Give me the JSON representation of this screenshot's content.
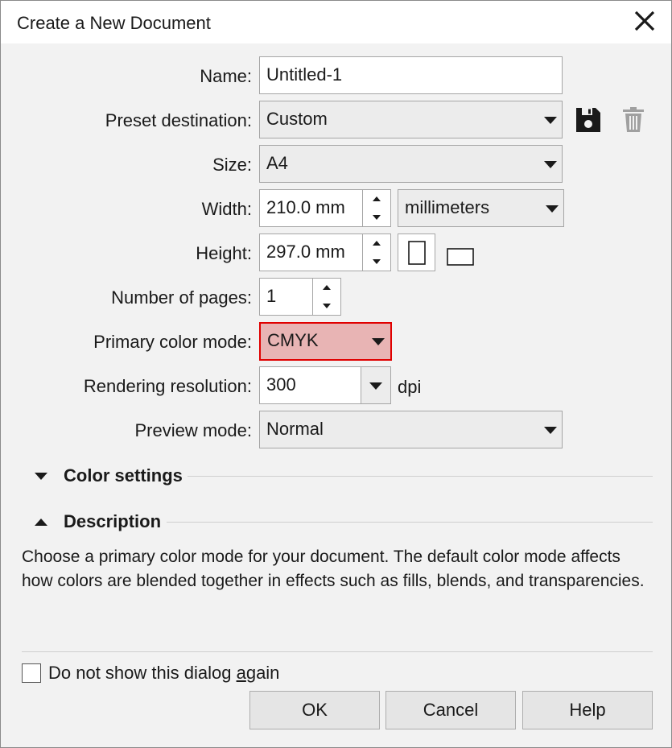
{
  "window": {
    "title": "Create a New Document"
  },
  "form": {
    "name_label": "Name:",
    "name_value": "Untitled-1",
    "preset_label": "Preset destination:",
    "preset_value": "Custom",
    "size_label": "Size:",
    "size_value": "A4",
    "width_label": "Width:",
    "width_value": "210.0 mm",
    "units_value": "millimeters",
    "height_label": "Height:",
    "height_value": "297.0 mm",
    "pages_label": "Number of pages:",
    "pages_value": "1",
    "color_mode_label": "Primary color mode:",
    "color_mode_value": "CMYK",
    "resolution_label": "Rendering resolution:",
    "resolution_value": "300",
    "resolution_unit": "dpi",
    "preview_label": "Preview mode:",
    "preview_value": "Normal"
  },
  "sections": {
    "color_settings": "Color settings",
    "description": "Description"
  },
  "description_text": "Choose a primary color mode for your document. The default color mode affects how colors are blended together in effects such as fills, blends, and transparencies.",
  "footer": {
    "dont_show_prefix": "Do not show this dialog ",
    "dont_show_accel": "a",
    "dont_show_suffix": "gain",
    "dont_show_checked": false,
    "ok_label": "OK",
    "cancel_label": "Cancel",
    "help_label": "Help"
  },
  "colors": {
    "highlight_fill": "#e8b4b4",
    "highlight_border": "#e00000",
    "dialog_bg": "#f2f2f2"
  },
  "icons": [
    "close-icon",
    "save-preset-icon",
    "delete-preset-icon",
    "portrait-icon",
    "landscape-icon",
    "chevron-down-icon",
    "expand-icon",
    "collapse-icon"
  ]
}
